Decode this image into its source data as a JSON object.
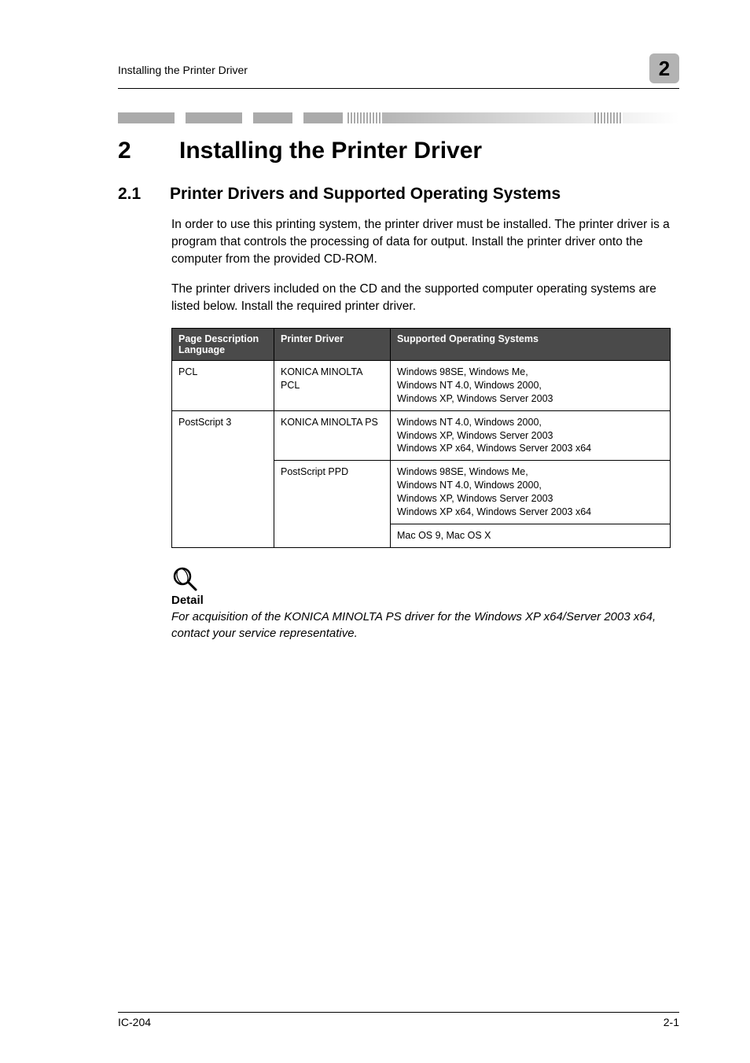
{
  "header": {
    "running_title": "Installing the Printer Driver",
    "chapter_num_badge": "2"
  },
  "chapter": {
    "number": "2",
    "title": "Installing the Printer Driver"
  },
  "section": {
    "number": "2.1",
    "title": "Printer Drivers and Supported Operating Systems"
  },
  "paragraphs": {
    "p1": "In order to use this printing system, the printer driver must be installed. The printer driver is a program that controls the processing of data for output. Install the printer driver onto the computer from the provided CD-ROM.",
    "p2": "The printer drivers included on the CD and the supported computer operating systems are listed below. Install the required printer driver."
  },
  "table": {
    "headers": {
      "col1": "Page Description Language",
      "col2": "Printer Driver",
      "col3": "Supported Operating Systems"
    },
    "rows": {
      "r1": {
        "lang": "PCL",
        "driver": "KONICA MINOLTA PCL",
        "os": "Windows 98SE, Windows Me,\nWindows NT 4.0, Windows 2000,\nWindows XP, Windows Server 2003"
      },
      "r2": {
        "lang": "PostScript 3",
        "driver": "KONICA MINOLTA PS",
        "os": "Windows NT 4.0, Windows 2000,\nWindows XP, Windows Server 2003\nWindows XP x64, Windows Server 2003 x64"
      },
      "r3": {
        "driver": "PostScript PPD",
        "os": "Windows 98SE, Windows Me,\nWindows NT 4.0, Windows 2000,\nWindows XP, Windows Server 2003\nWindows XP x64, Windows Server 2003 x64"
      },
      "r4": {
        "os": "Mac OS 9, Mac OS X"
      }
    }
  },
  "detail": {
    "label": "Detail",
    "text": "For acquisition of the KONICA MINOLTA PS driver for the Windows XP x64/Server 2003 x64, contact your service representative."
  },
  "footer": {
    "left": "IC-204",
    "right": "2-1"
  }
}
